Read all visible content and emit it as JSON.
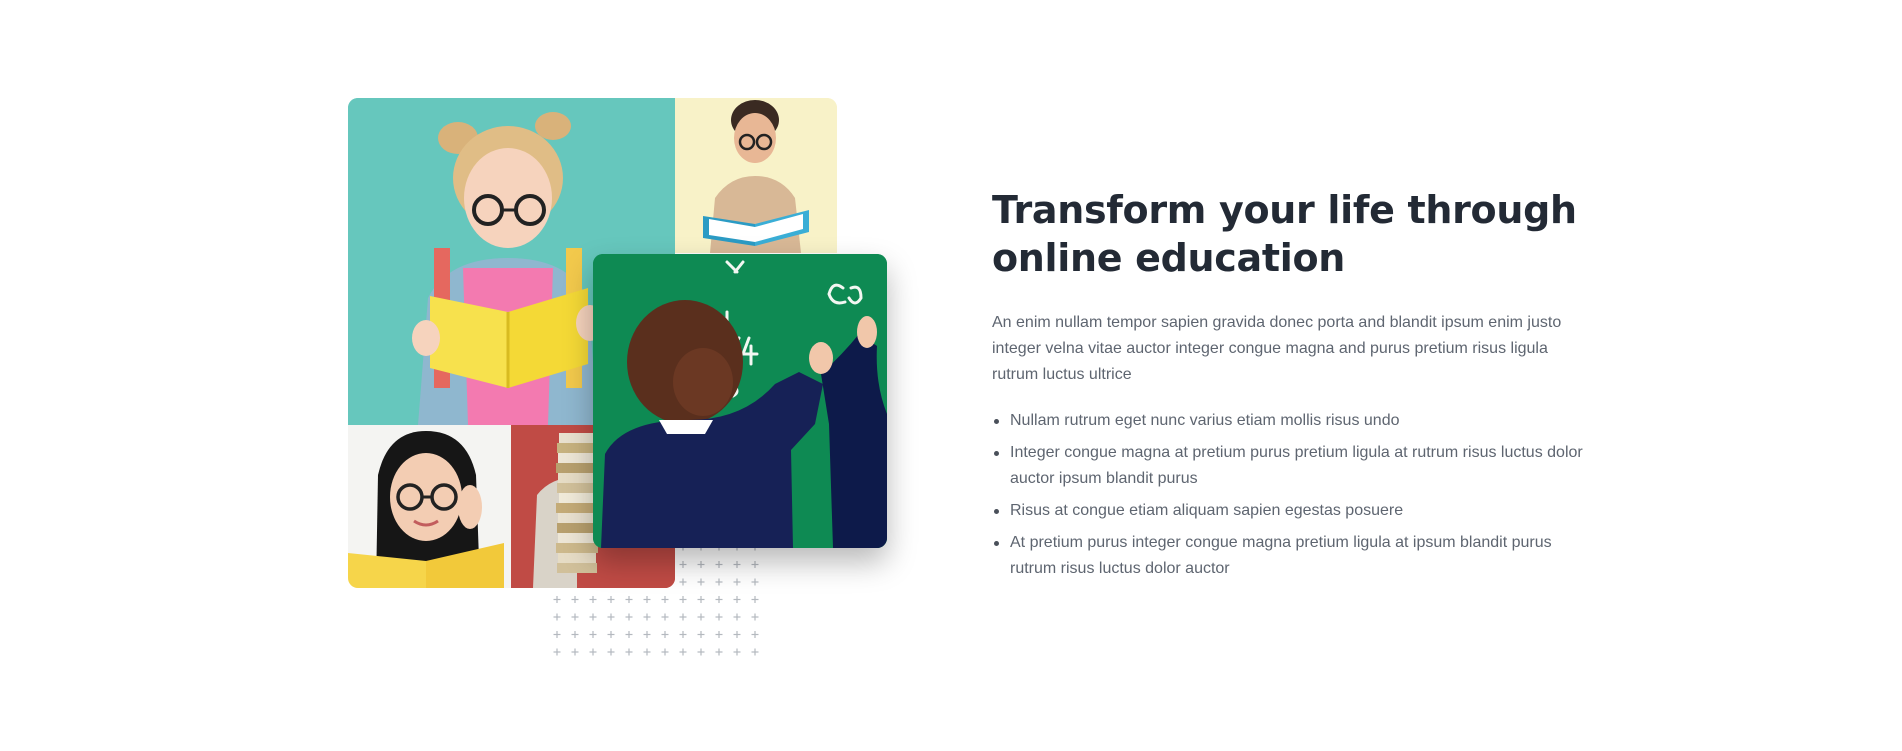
{
  "section": {
    "heading_line1": "Transform your life through",
    "heading_line2": "online education",
    "intro": "An enim nullam tempor sapien gravida donec porta and blandit ipsum enim justo integer velna vitae auctor integer congue magna and purus pretium risus ligula rutrum luctus ultrice",
    "bullets": [
      "Nullam rutrum eget nunc varius etiam mollis risus undo",
      "Integer congue magna at pretium purus pretium ligula at rutrum risus luctus dolor auctor ipsum blandit purus",
      "Risus at congue etiam aliquam sapien egestas posuere",
      "At pretium purus integer congue magna pretium ligula at ipsum blandit purus rutrum risus luctus dolor auctor"
    ]
  },
  "colors": {
    "heading": "#232a35",
    "body_text": "#5e6570",
    "tile_teal": "#66c7bd",
    "tile_cream": "#f8f2c8",
    "tile_red": "#c04b45",
    "chalkboard": "#0e8a53"
  },
  "images": {
    "girl_photo": "girl-reading-yellow-book",
    "boy_photo": "boy-reading-blue-book",
    "woman_photo": "woman-with-glasses-holding-book",
    "books_photo": "child-carrying-stack-of-books",
    "board_photo": "child-writing-on-chalkboard"
  }
}
